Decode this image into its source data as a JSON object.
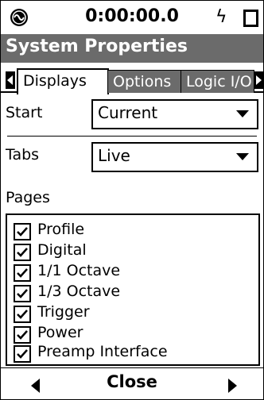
{
  "status": {
    "logo_icon": "meter-logo-icon",
    "time": "0:00:00.0",
    "power_icon": "power-bolt-icon",
    "battery_icon": "battery-icon"
  },
  "window": {
    "title": "System Properties"
  },
  "tabs": [
    {
      "label": "Displays",
      "active": true
    },
    {
      "label": "Options",
      "active": false
    },
    {
      "label": "Logic I/O",
      "active": false
    }
  ],
  "start": {
    "label": "Start",
    "value": "Current"
  },
  "tabs_setting": {
    "label": "Tabs",
    "value": "Live"
  },
  "pages": {
    "label": "Pages",
    "items": [
      {
        "label": "Profile",
        "checked": true
      },
      {
        "label": "Digital",
        "checked": true
      },
      {
        "label": "1/1 Octave",
        "checked": true
      },
      {
        "label": "1/3 Octave",
        "checked": true
      },
      {
        "label": "Trigger",
        "checked": true
      },
      {
        "label": "Power",
        "checked": true
      },
      {
        "label": "Preamp Interface",
        "checked": true
      }
    ]
  },
  "bottom": {
    "close_label": "Close"
  }
}
